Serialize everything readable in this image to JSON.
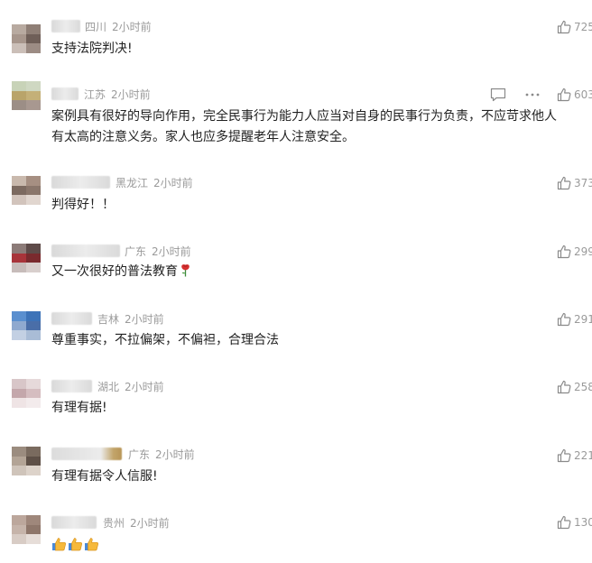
{
  "comments": [
    {
      "region": "四川",
      "time": "2小时前",
      "text": "支持法院判决!",
      "likes": "725",
      "avatar": [
        "#b8aaa0",
        "#8f7f76",
        "#a7968c",
        "#6f5f58",
        "#cbbfb8",
        "#9c8c84"
      ]
    },
    {
      "region": "江苏",
      "time": "2小时前",
      "text_line1": "案例具有很好的导向作用，完全民事行为能力人应当对自身的民事行为负责，不应苛求他人",
      "text_line2": "有太高的注意义务。家人也应多提醒老年人注意安全。",
      "likes": "603",
      "avatar": [
        "#c8d3b8",
        "#cfd8c2",
        "#b9a46a",
        "#c4b078",
        "#9c8e86",
        "#a89890"
      ]
    },
    {
      "region": "黑龙江",
      "time": "2小时前",
      "text": "判得好！！",
      "likes": "373",
      "avatar": [
        "#c9b9ad",
        "#a68f82",
        "#7c6a60",
        "#8a766b",
        "#d2c4bc",
        "#e1d6cf"
      ]
    },
    {
      "region": "广东",
      "time": "2小时前",
      "text": "又一次很好的普法教育",
      "likes": "299",
      "avatar": [
        "#8c7b78",
        "#5e4b49",
        "#a8343a",
        "#7a2a2e",
        "#c7bcba",
        "#d8cfcd"
      ]
    },
    {
      "region": "吉林",
      "time": "2小时前",
      "text": "尊重事实，不拉偏架，不偏袒，合理合法",
      "likes": "291",
      "avatar": [
        "#5a8fcf",
        "#3d73b8",
        "#8fa9cf",
        "#4a6ea8",
        "#c3d0e3",
        "#a9bcd6"
      ]
    },
    {
      "region": "湖北",
      "time": "2小时前",
      "text": "有理有据!",
      "likes": "258",
      "avatar": [
        "#d8c6c8",
        "#e6d9da",
        "#c4a7ab",
        "#d5bdc0",
        "#efe4e5",
        "#f3ebec"
      ]
    },
    {
      "region": "广东",
      "time": "2小时前",
      "text": "有理有据令人信服!",
      "likes": "221",
      "avatar": [
        "#9b8c7f",
        "#7a6b5f",
        "#b3a496",
        "#5e5047",
        "#cfc4ba",
        "#ddd3ca"
      ]
    },
    {
      "region": "贵州",
      "time": "2小时前",
      "text": "",
      "likes": "130",
      "avatar": [
        "#bca79c",
        "#9f877b",
        "#c6b4aa",
        "#8e766a",
        "#d8ccc5",
        "#e6ddd8"
      ]
    }
  ],
  "icons": {
    "like": "thumbs-up-outline-icon",
    "reply": "comment-bubble-icon",
    "more": "more-dots-icon",
    "rose": "rose-emoji-icon",
    "thumbs": "thumbs-up-emoji-icon"
  }
}
